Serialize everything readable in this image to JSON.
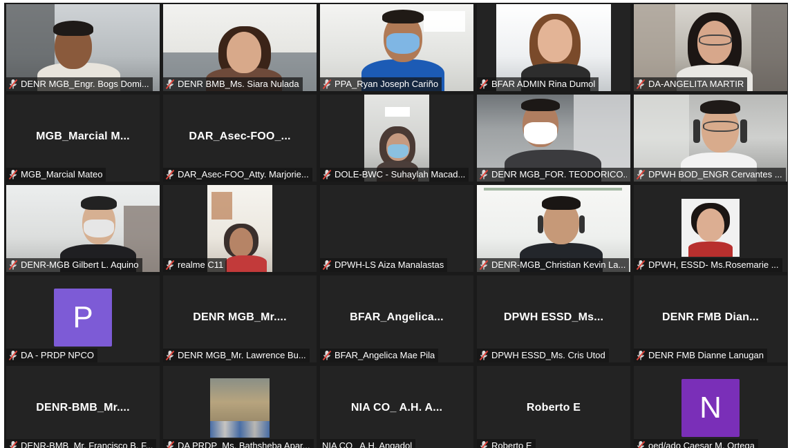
{
  "colors": {
    "muted_mic": "#e0453b",
    "avatar_p": "#7d5bd6",
    "avatar_n": "#7a2fb8",
    "tile_bg": "#232323"
  },
  "participants": [
    {
      "label": "DENR MGB_Engr. Bogs Domi...",
      "muted": true,
      "video": true
    },
    {
      "label": "DENR BMB_Ms. Siara Nulada",
      "muted": true,
      "video": true
    },
    {
      "label": "PPA_Ryan Joseph Cariño",
      "muted": true,
      "video": true
    },
    {
      "label": "BFAR ADMIN Rina Dumol",
      "muted": true,
      "video": true
    },
    {
      "label": "DA-ANGELITA MARTIR",
      "muted": true,
      "video": true
    },
    {
      "label": "MGB_Marcial Mateo",
      "center_name": "MGB_Marcial  M...",
      "muted": true,
      "video": false
    },
    {
      "label": "DAR_Asec-FOO_Atty. Marjorie...",
      "center_name": "DAR_Asec-FOO_...",
      "muted": true,
      "video": false
    },
    {
      "label": "DOLE-BWC - Suhaylah Macad...",
      "muted": true,
      "video": true
    },
    {
      "label": "DENR MGB_FOR. TEODORICO...",
      "muted": true,
      "video": true
    },
    {
      "label": "DPWH BOD_ENGR Cervantes ...",
      "muted": true,
      "video": true
    },
    {
      "label": "DENR-MGB Gilbert L. Aquino",
      "muted": true,
      "video": true
    },
    {
      "label": "realme C11",
      "muted": true,
      "video": true
    },
    {
      "label": "DPWH-LS Aiza Manalastas",
      "muted": true,
      "video": false
    },
    {
      "label": "DENR-MGB_Christian Kevin La...",
      "muted": true,
      "video": true
    },
    {
      "label": "DPWH, ESSD- Ms.Rosemarie ...",
      "muted": true,
      "video": true
    },
    {
      "label": "DA - PRDP NPCO",
      "avatar_letter": "P",
      "muted": true,
      "video": false
    },
    {
      "label": "DENR MGB_Mr. Lawrence Bu...",
      "center_name": "DENR  MGB_Mr....",
      "muted": true,
      "video": false
    },
    {
      "label": "BFAR_Angelica Mae Pila",
      "center_name": "BFAR_Angelica...",
      "muted": true,
      "video": false
    },
    {
      "label": "DPWH ESSD_Ms. Cris Utod",
      "center_name": "DPWH  ESSD_Ms...",
      "muted": true,
      "video": false
    },
    {
      "label": "DENR FMB Dianne Lanugan",
      "center_name": "DENR FMB  Dian...",
      "muted": true,
      "video": false
    },
    {
      "label": "DENR-BMB_Mr. Francisco B. F...",
      "center_name": "DENR-BMB_Mr....",
      "muted": true,
      "video": false
    },
    {
      "label": "DA PRDP_Ms. Bathsheba Apar...",
      "muted": true,
      "video": true
    },
    {
      "label": "NIA CO_ A.H. Angadol",
      "center_name": "NIA CO_ A.H. A...",
      "muted": false,
      "video": false
    },
    {
      "label": "Roberto E",
      "center_name": "Roberto E",
      "muted": true,
      "video": false
    },
    {
      "label": "oed/ado Caesar M. Ortega",
      "avatar_letter": "N",
      "muted": true,
      "video": false
    }
  ]
}
